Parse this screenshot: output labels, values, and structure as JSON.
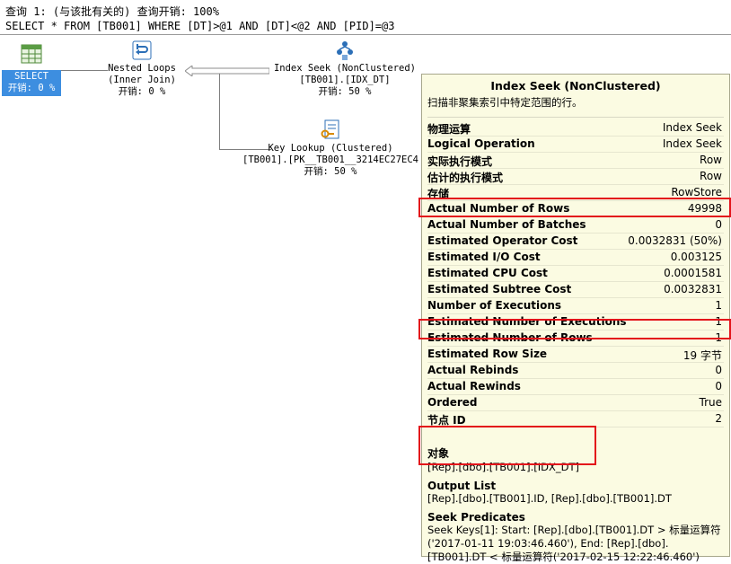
{
  "query": {
    "header": "查询 1: (与该批有关的) 查询开销: 100%",
    "sql": "SELECT * FROM [TB001] WHERE [DT]>@1 AND [DT]<@2 AND [PID]=@3"
  },
  "plan": {
    "select": {
      "label": "SELECT",
      "cost": "开销: 0 %"
    },
    "nested_loops": {
      "line1": "Nested Loops",
      "line2": "(Inner Join)",
      "cost": "开销: 0 %"
    },
    "index_seek": {
      "line1": "Index Seek (NonClustered)",
      "line2": "[TB001].[IDX_DT]",
      "cost": "开销: 50 %"
    },
    "key_lookup": {
      "line1": "Key Lookup (Clustered)",
      "line2": "[TB001].[PK__TB001__3214EC27EC4",
      "cost": "开销: 50 %"
    }
  },
  "tooltip": {
    "title": "Index Seek (NonClustered)",
    "description": "扫描非聚集索引中特定范围的行。",
    "rows": [
      {
        "k": "物理运算",
        "v": "Index Seek"
      },
      {
        "k": "Logical Operation",
        "v": "Index Seek"
      },
      {
        "k": "实际执行模式",
        "v": "Row"
      },
      {
        "k": "估计的执行模式",
        "v": "Row"
      },
      {
        "k": "存储",
        "v": "RowStore"
      },
      {
        "k": "Actual Number of Rows",
        "v": "49998"
      },
      {
        "k": "Actual Number of Batches",
        "v": "0"
      },
      {
        "k": "Estimated Operator Cost",
        "v": "0.0032831 (50%)"
      },
      {
        "k": "Estimated I/O Cost",
        "v": "0.003125"
      },
      {
        "k": "Estimated CPU Cost",
        "v": "0.0001581"
      },
      {
        "k": "Estimated Subtree Cost",
        "v": "0.0032831"
      },
      {
        "k": "Number of Executions",
        "v": "1"
      },
      {
        "k": "Estimated Number of Executions",
        "v": "1"
      },
      {
        "k": "Estimated Number of Rows",
        "v": "1"
      },
      {
        "k": "Estimated Row Size",
        "v": "19 字节"
      },
      {
        "k": "Actual Rebinds",
        "v": "0"
      },
      {
        "k": "Actual Rewinds",
        "v": "0"
      },
      {
        "k": "Ordered",
        "v": "True"
      },
      {
        "k": "节点 ID",
        "v": "2"
      }
    ],
    "object_header": "对象",
    "object_value": "[Rep].[dbo].[TB001].[IDX_DT]",
    "output_header": "Output List",
    "output_value": "[Rep].[dbo].[TB001].ID, [Rep].[dbo].[TB001].DT",
    "seek_header": "Seek Predicates",
    "seek_value": "Seek Keys[1]: Start: [Rep].[dbo].[TB001].DT > 标量运算符('2017-01-11 19:03:46.460'), End: [Rep].[dbo].[TB001].DT < 标量运算符('2017-02-15 12:22:46.460')"
  },
  "colors": {
    "highlight": "#e3141b",
    "tooltip_bg": "#fbfbe2",
    "select_bg": "#3d8ee0"
  }
}
